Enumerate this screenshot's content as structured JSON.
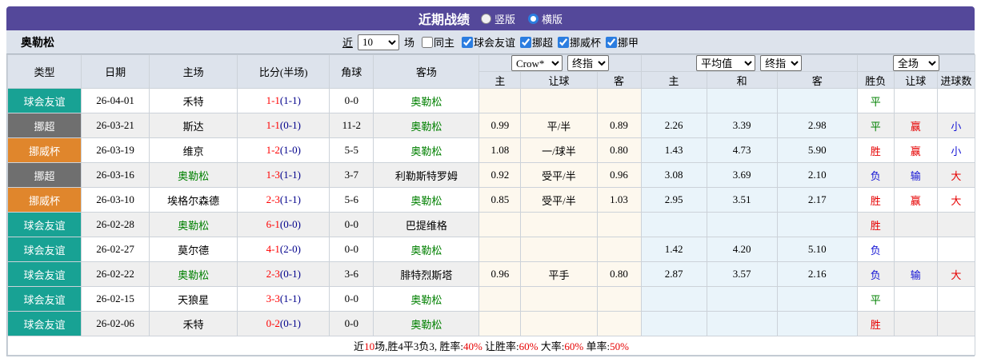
{
  "title_bar": {
    "title": "近期战绩",
    "radios": [
      {
        "label": "竖版",
        "checked": false
      },
      {
        "label": "横版",
        "checked": true
      }
    ]
  },
  "filter_bar": {
    "team": "奥勒松",
    "recent_link": "近",
    "recent_value": "10",
    "matches_label": "场",
    "same_home": {
      "label": "同主",
      "checked": false
    },
    "leagues": [
      {
        "label": "球会友谊",
        "checked": true
      },
      {
        "label": "挪超",
        "checked": true
      },
      {
        "label": "挪威杯",
        "checked": true
      },
      {
        "label": "挪甲",
        "checked": true
      }
    ]
  },
  "table": {
    "left_headers": [
      "类型",
      "日期",
      "主场",
      "比分(半场)",
      "角球",
      "客场"
    ],
    "selects": {
      "crow": "Crow*",
      "crow_final": "终指",
      "avg": "平均值",
      "avg_final": "终指",
      "fullmatch": "全场"
    },
    "sub_headers": [
      "主",
      "让球",
      "客",
      "主",
      "和",
      "客",
      "胜负",
      "让球",
      "进球数"
    ],
    "rows": [
      {
        "type": "球会友谊",
        "date": "26-04-01",
        "home": "禾特",
        "home_self": false,
        "score": "1-1",
        "half": "(1-1)",
        "corner": "0-0",
        "away": "奥勒松",
        "away_self": true,
        "crow": [
          "",
          "",
          ""
        ],
        "avg": [
          "",
          "",
          ""
        ],
        "result": "平",
        "handicap": "",
        "goals": ""
      },
      {
        "type": "挪超",
        "date": "26-03-21",
        "home": "斯达",
        "home_self": false,
        "score": "1-1",
        "half": "(0-1)",
        "corner": "11-2",
        "away": "奥勒松",
        "away_self": true,
        "crow": [
          "0.99",
          "平/半",
          "0.89"
        ],
        "avg": [
          "2.26",
          "3.39",
          "2.98"
        ],
        "result": "平",
        "handicap": "赢",
        "goals": "小"
      },
      {
        "type": "挪威杯",
        "date": "26-03-19",
        "home": "维京",
        "home_self": false,
        "score": "1-2",
        "half": "(1-0)",
        "corner": "5-5",
        "away": "奥勒松",
        "away_self": true,
        "crow": [
          "1.08",
          "一/球半",
          "0.80"
        ],
        "avg": [
          "1.43",
          "4.73",
          "5.90"
        ],
        "result": "胜",
        "handicap": "赢",
        "goals": "小"
      },
      {
        "type": "挪超",
        "date": "26-03-16",
        "home": "奥勒松",
        "home_self": true,
        "score": "1-3",
        "half": "(1-1)",
        "corner": "3-7",
        "away": "利勒斯特罗姆",
        "away_self": false,
        "crow": [
          "0.92",
          "受平/半",
          "0.96"
        ],
        "avg": [
          "3.08",
          "3.69",
          "2.10"
        ],
        "result": "负",
        "handicap": "输",
        "goals": "大"
      },
      {
        "type": "挪威杯",
        "date": "26-03-10",
        "home": "埃格尔森德",
        "home_self": false,
        "score": "2-3",
        "half": "(1-1)",
        "corner": "5-6",
        "away": "奥勒松",
        "away_self": true,
        "crow": [
          "0.85",
          "受平/半",
          "1.03"
        ],
        "avg": [
          "2.95",
          "3.51",
          "2.17"
        ],
        "result": "胜",
        "handicap": "赢",
        "goals": "大"
      },
      {
        "type": "球会友谊",
        "date": "26-02-28",
        "home": "奥勒松",
        "home_self": true,
        "score": "6-1",
        "half": "(0-0)",
        "corner": "0-0",
        "away": "巴提维格",
        "away_self": false,
        "crow": [
          "",
          "",
          ""
        ],
        "avg": [
          "",
          "",
          ""
        ],
        "result": "胜",
        "handicap": "",
        "goals": ""
      },
      {
        "type": "球会友谊",
        "date": "26-02-27",
        "home": "莫尔德",
        "home_self": false,
        "score": "4-1",
        "half": "(2-0)",
        "corner": "0-0",
        "away": "奥勒松",
        "away_self": true,
        "crow": [
          "",
          "",
          ""
        ],
        "avg": [
          "1.42",
          "4.20",
          "5.10"
        ],
        "result": "负",
        "handicap": "",
        "goals": ""
      },
      {
        "type": "球会友谊",
        "date": "26-02-22",
        "home": "奥勒松",
        "home_self": true,
        "score": "2-3",
        "half": "(0-1)",
        "corner": "3-6",
        "away": "腓特烈斯塔",
        "away_self": false,
        "crow": [
          "0.96",
          "平手",
          "0.80"
        ],
        "avg": [
          "2.87",
          "3.57",
          "2.16"
        ],
        "result": "负",
        "handicap": "输",
        "goals": "大"
      },
      {
        "type": "球会友谊",
        "date": "26-02-15",
        "home": "天狼星",
        "home_self": false,
        "score": "3-3",
        "half": "(1-1)",
        "corner": "0-0",
        "away": "奥勒松",
        "away_self": true,
        "crow": [
          "",
          "",
          ""
        ],
        "avg": [
          "",
          "",
          ""
        ],
        "result": "平",
        "handicap": "",
        "goals": ""
      },
      {
        "type": "球会友谊",
        "date": "26-02-06",
        "home": "禾特",
        "home_self": false,
        "score": "0-2",
        "half": "(0-1)",
        "corner": "0-0",
        "away": "奥勒松",
        "away_self": true,
        "crow": [
          "",
          "",
          ""
        ],
        "avg": [
          "",
          "",
          ""
        ],
        "result": "胜",
        "handicap": "",
        "goals": ""
      }
    ]
  },
  "summary": {
    "parts": [
      {
        "text": "近",
        "red": false
      },
      {
        "text": "10",
        "red": true
      },
      {
        "text": "场,胜4平3负3, 胜率:",
        "red": false
      },
      {
        "text": "40%",
        "red": true
      },
      {
        "text": " 让胜率:",
        "red": false
      },
      {
        "text": "60%",
        "red": true
      },
      {
        "text": " 大率:",
        "red": false
      },
      {
        "text": "60%",
        "red": true
      },
      {
        "text": " 单率:",
        "red": false
      },
      {
        "text": "50%",
        "red": true
      }
    ]
  },
  "colors": {
    "type_badge": {
      "球会友谊": "#18a294",
      "挪超": "#6f6f6f",
      "挪威杯": "#e0862c"
    },
    "outcome": {
      "胜": "#e60000",
      "平": "#008000",
      "负": "#1414d4",
      "赢": "#e60000",
      "输": "#1414d4",
      "大": "#e60000",
      "小": "#1414d4"
    },
    "self_team": "#008000",
    "summary_red": "#e60000",
    "header_purple": "#54489a"
  }
}
